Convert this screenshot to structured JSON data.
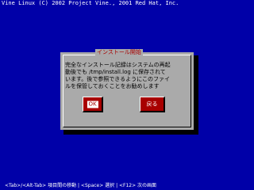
{
  "banner": {
    "text": "Vine Linux (C) 2002 Project Vine., 2001 Red Hat, Inc."
  },
  "dialog": {
    "title": "インストール開始",
    "lines": [
      "完全なインストール記録はシステムの再起",
      "動後でも /tmp/install.log に保存されて",
      "います。後で参照できるようにこのファイ",
      "ルを保管しておくことをお勧めします"
    ],
    "ok_label": "OK",
    "back_label": "戻る"
  },
  "help": {
    "text": "<Tab>/<Alt-Tab> 項目間の移動 | <Space> 選択 | <F12> 次の画面"
  },
  "colors": {
    "background": "#0000a8",
    "dialog": "#aaaaaa",
    "button": "#a80000",
    "title_text": "#a80000"
  }
}
